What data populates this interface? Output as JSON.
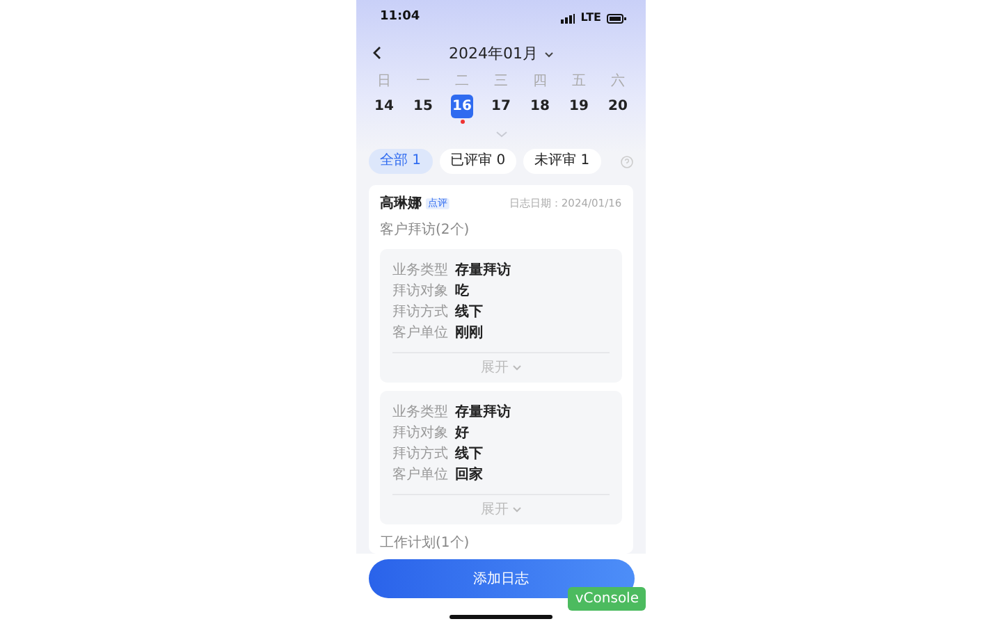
{
  "status_bar": {
    "time": "11:04",
    "network": "LTE"
  },
  "header": {
    "title": "2024年01月"
  },
  "week": [
    {
      "weekday": "日",
      "date": "14",
      "selected": false,
      "has_log": false
    },
    {
      "weekday": "一",
      "date": "15",
      "selected": false,
      "has_log": false
    },
    {
      "weekday": "二",
      "date": "16",
      "selected": true,
      "has_log": true
    },
    {
      "weekday": "三",
      "date": "17",
      "selected": false,
      "has_log": false
    },
    {
      "weekday": "四",
      "date": "18",
      "selected": false,
      "has_log": false
    },
    {
      "weekday": "五",
      "date": "19",
      "selected": false,
      "has_log": false
    },
    {
      "weekday": "六",
      "date": "20",
      "selected": false,
      "has_log": false
    }
  ],
  "filters": [
    {
      "label": "全部 1",
      "selected": true
    },
    {
      "label": "已评审 0",
      "selected": false
    },
    {
      "label": "未评审 1",
      "selected": false
    }
  ],
  "log": {
    "name": "高琳娜",
    "tag": "点评",
    "date": "日志日期：2024/01/16",
    "section": "客户拜访(2个)",
    "visits": [
      {
        "fields": [
          {
            "label": "业务类型",
            "value": "存量拜访"
          },
          {
            "label": "拜访对象",
            "value": "吃"
          },
          {
            "label": "拜访方式",
            "value": "线下"
          },
          {
            "label": "客户单位",
            "value": "刚刚"
          }
        ],
        "expand": "展开"
      },
      {
        "fields": [
          {
            "label": "业务类型",
            "value": "存量拜访"
          },
          {
            "label": "拜访对象",
            "value": "好"
          },
          {
            "label": "拜访方式",
            "value": "线下"
          },
          {
            "label": "客户单位",
            "value": "回家"
          }
        ],
        "expand": "展开"
      }
    ],
    "next_section": "工作计划(1个)"
  },
  "add_button": "添加日志",
  "debug_button": "vConsole"
}
